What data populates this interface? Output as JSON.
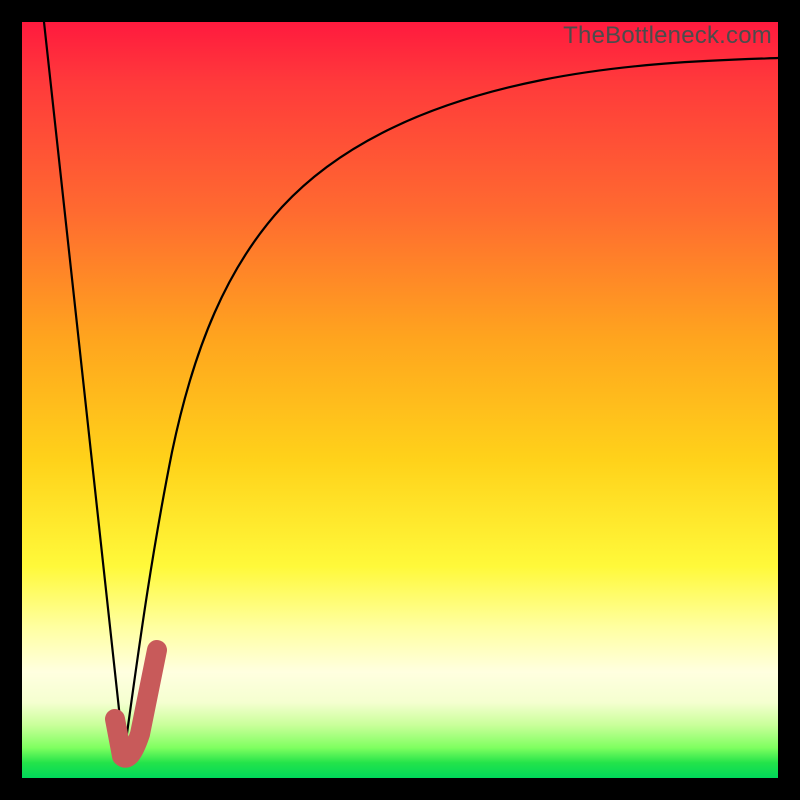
{
  "watermark": "TheBottleneck.com",
  "colors": {
    "frame": "#000000",
    "gradient_top": "#ff1a3e",
    "gradient_mid": "#ffd21a",
    "gradient_bottom": "#00d85a",
    "curve": "#000000",
    "accent": "#c85a5a"
  },
  "chart_data": {
    "type": "line",
    "title": "",
    "xlabel": "",
    "ylabel": "",
    "xlim": [
      0,
      100
    ],
    "ylim": [
      0,
      100
    ],
    "grid": false,
    "legend": false,
    "series": [
      {
        "name": "left-descent",
        "x": [
          3,
          13.5
        ],
        "values": [
          100,
          3
        ]
      },
      {
        "name": "right-ascent",
        "x": [
          13.5,
          16,
          19,
          23,
          28,
          35,
          45,
          58,
          75,
          100
        ],
        "values": [
          3,
          20,
          37,
          52,
          64,
          74,
          82,
          88,
          92,
          95
        ]
      },
      {
        "name": "accent-J",
        "x": [
          12.5,
          13.5,
          15.5,
          17.5
        ],
        "values": [
          5,
          3,
          6,
          18
        ]
      }
    ],
    "annotations": []
  }
}
